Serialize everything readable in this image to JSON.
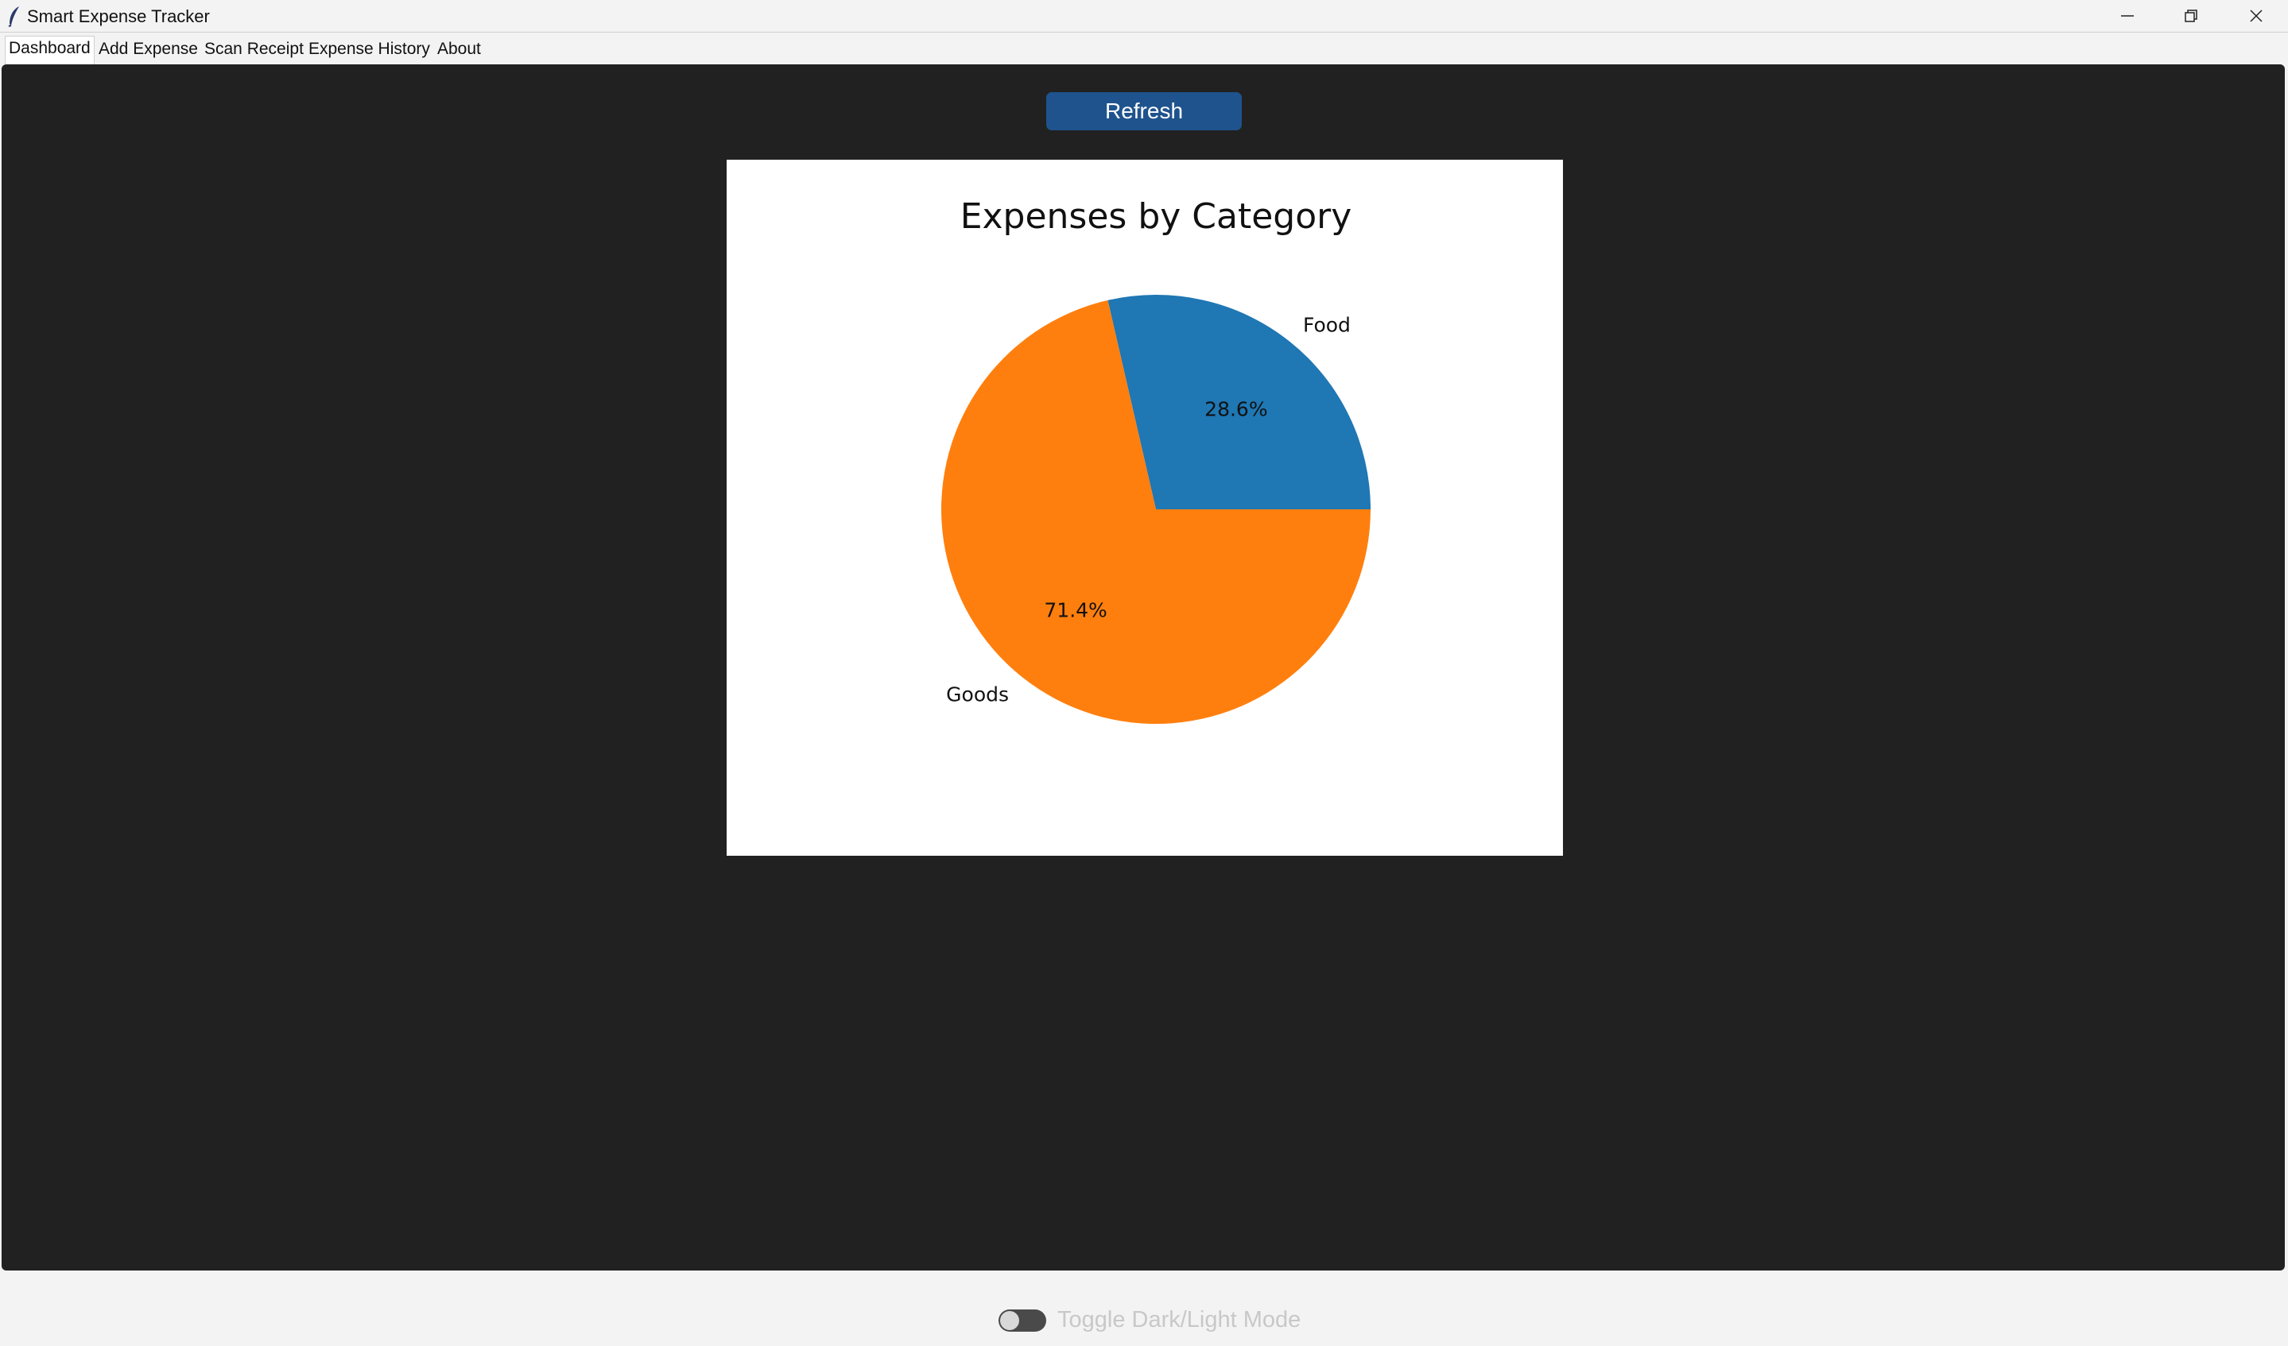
{
  "window": {
    "title": "Smart Expense Tracker"
  },
  "tabs": [
    {
      "label": "Dashboard",
      "active": true
    },
    {
      "label": "Add Expense",
      "active": false
    },
    {
      "label": "Scan Receipt",
      "active": false
    },
    {
      "label": "Expense History",
      "active": false
    },
    {
      "label": "About",
      "active": false
    }
  ],
  "dashboard": {
    "refresh_label": "Refresh"
  },
  "chart_data": {
    "type": "pie",
    "title": "Expenses by Category",
    "categories": [
      "Food",
      "Goods"
    ],
    "values": [
      28.6,
      71.4
    ],
    "value_labels": [
      "28.6%",
      "71.4%"
    ],
    "colors": [
      "#1f77b4",
      "#ff7f0e"
    ],
    "start_angle_deg": 0,
    "direction": "counterclockwise"
  },
  "footer": {
    "toggle_label": "Toggle Dark/Light Mode",
    "toggle_on": false
  },
  "colors": {
    "panel_bg": "#212121",
    "button_bg": "#1f538d",
    "chrome_bg": "#f3f3f3"
  }
}
